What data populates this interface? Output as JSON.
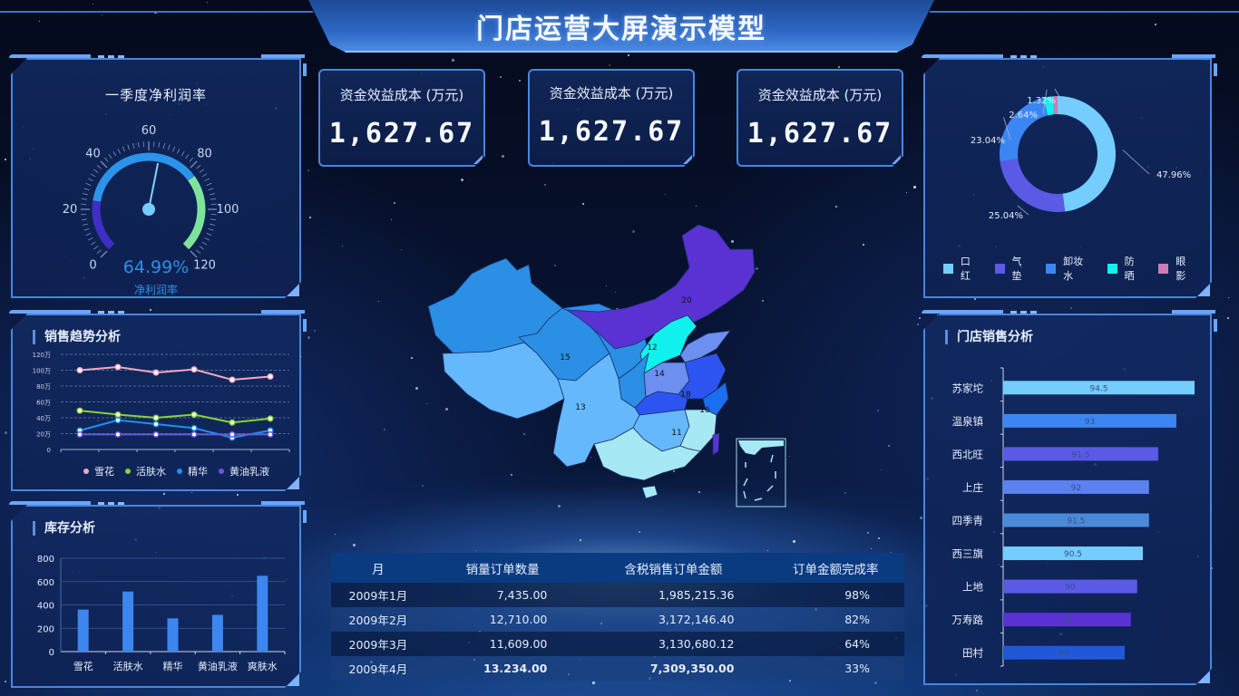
{
  "header": {
    "title": "门店运营大屏演示模型"
  },
  "kpis": [
    {
      "label": "资金效益成本 (万元)",
      "value": "1,627.67"
    },
    {
      "label": "资金效益成本 (万元)",
      "value": "1,627.67"
    },
    {
      "label": "资金效益成本 (万元)",
      "value": "1,627.67"
    }
  ],
  "gauge": {
    "title": "一季度净利润率",
    "value_text": "64.99%",
    "value": 64.99,
    "caption": "净利润率",
    "min": 0,
    "max": 120,
    "tick_labels": [
      "0",
      "20",
      "40",
      "60",
      "80",
      "100",
      "120"
    ],
    "bands": [
      {
        "to": 0.2,
        "color": "#3e2fc4"
      },
      {
        "to": 0.7,
        "color": "#2b93ea"
      },
      {
        "to": 1.0,
        "color": "#7ee39a"
      }
    ],
    "value_color": "#2f8fe8"
  },
  "sales_trend": {
    "title": "销售趋势分析",
    "chart_data": {
      "type": "line",
      "title": "销售趋势分析",
      "y_tick_labels": [
        "0",
        "20万",
        "40万",
        "60万",
        "80万",
        "100万",
        "120万"
      ],
      "ylim": [
        0,
        120
      ],
      "y_unit": "万",
      "x_points": 6,
      "grid": true,
      "legend_position": "bottom",
      "series": [
        {
          "name": "雪花",
          "color": "#f4a8c0",
          "values": [
            100,
            104,
            97,
            101,
            88,
            92
          ]
        },
        {
          "name": "活肤水",
          "color": "#8bd13a",
          "values": [
            49,
            44,
            40,
            44,
            34,
            39
          ]
        },
        {
          "name": "精华",
          "color": "#1e90ee",
          "values": [
            24,
            37,
            32,
            27,
            15,
            24
          ]
        },
        {
          "name": "黄油乳液",
          "color": "#6a55e0",
          "values": [
            19,
            19,
            19,
            19,
            19,
            19
          ]
        }
      ]
    }
  },
  "inventory": {
    "title": "库存分析",
    "chart_data": {
      "type": "bar",
      "title": "库存分析",
      "categories": [
        "雪花",
        "活肤水",
        "精华",
        "黄油乳液",
        "爽肤水"
      ],
      "values": [
        360,
        515,
        285,
        315,
        650
      ],
      "y_tick_labels": [
        "0",
        "200",
        "400",
        "600",
        "800"
      ],
      "ylim": [
        0,
        800
      ],
      "color": "#3d86f0",
      "grid": true
    }
  },
  "category_share": {
    "chart_data": {
      "type": "pie",
      "donut": true,
      "slices": [
        {
          "name": "口红",
          "value": 47.96,
          "label": "47.96%",
          "color": "#74cdfc"
        },
        {
          "name": "气垫",
          "value": 25.04,
          "label": "25.04%",
          "color": "#5a5ae6"
        },
        {
          "name": "卸妆水",
          "value": 23.04,
          "label": "23.04%",
          "color": "#3b86f2"
        },
        {
          "name": "防晒",
          "value": 2.64,
          "label": "2.64%",
          "color": "#11f2ee"
        },
        {
          "name": "眼影",
          "value": 1.32,
          "label": "1.32%",
          "color": "#c97cb6"
        }
      ],
      "legend_position": "bottom"
    }
  },
  "store_sales": {
    "title": "门店销售分析",
    "chart_data": {
      "type": "bar",
      "orientation": "horizontal",
      "title": "门店销售分析",
      "categories": [
        "苏家坨",
        "温泉镇",
        "西北旺",
        "上庄",
        "四季青",
        "西三旗",
        "上地",
        "万寿路",
        "田村"
      ],
      "values": [
        94.5,
        93,
        91.5,
        92,
        91.5,
        90.5,
        90,
        90,
        90
      ],
      "labels": [
        "94.5",
        "93",
        "91.5",
        "92",
        "91.5",
        "90.5",
        "90",
        "90",
        "90"
      ],
      "bar_fraction": [
        1.0,
        0.905,
        0.81,
        0.762,
        0.762,
        0.73,
        0.7,
        0.667,
        0.635
      ],
      "colors": [
        "#74cdfc",
        "#3b86f2",
        "#5a5ae6",
        "#5b82ee",
        "#4a8ad8",
        "#74cdfc",
        "#5a5ae6",
        "#5a32d4",
        "#2058d8"
      ]
    }
  },
  "map": {
    "region_labels": [
      {
        "text": "20"
      },
      {
        "text": "12"
      },
      {
        "text": "15"
      },
      {
        "text": "14"
      },
      {
        "text": "18"
      },
      {
        "text": "13"
      },
      {
        "text": "16"
      },
      {
        "text": "11"
      }
    ]
  },
  "sales_table": {
    "columns": [
      "月",
      "销量订单数量",
      "含税销售订单金额",
      "订单金额完成率"
    ],
    "rows": [
      [
        "2009年1月",
        "7,435.00",
        "1,985,215.36",
        "98%"
      ],
      [
        "2009年2月",
        "12,710.00",
        "3,172,146.40",
        "82%"
      ],
      [
        "2009年3月",
        "11,609.00",
        "3,130,680.12",
        "64%"
      ],
      [
        "2009年4月",
        "13.234.00",
        "7,309,350.00",
        "33%"
      ]
    ]
  }
}
